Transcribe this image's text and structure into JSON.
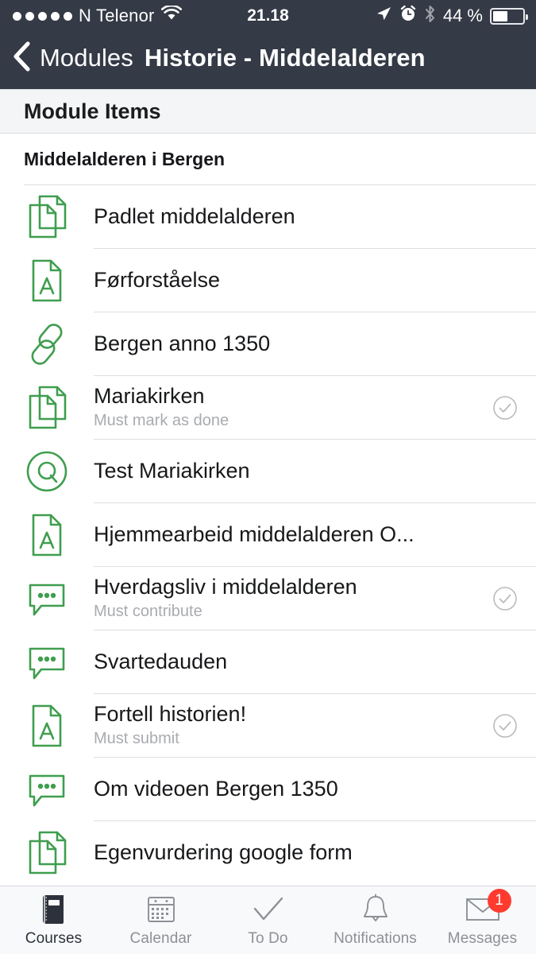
{
  "status_bar": {
    "signal_dots": 5,
    "carrier": "N Telenor",
    "wifi_icon": "wifi-icon",
    "time": "21.18",
    "location_icon": "location-arrow-icon",
    "alarm_icon": "alarm-clock-icon",
    "bluetooth_icon": "bluetooth-icon",
    "battery_percent": "44 %",
    "battery_icon": "battery-icon"
  },
  "navbar": {
    "back_icon": "chevron-left-icon",
    "back_label": "Modules",
    "title": "Historie - Middelalderen"
  },
  "section_header": {
    "label": "Module Items"
  },
  "module": {
    "title": "Middelalderen i Bergen"
  },
  "colors": {
    "navbar_bg": "#343a46",
    "icon_green": "#3f9e4f",
    "section_bg": "#f4f5f6",
    "separator": "#dcdee1",
    "subtitle_gray": "#a9abb0",
    "badge_red": "#ff3b30",
    "tab_inactive": "#8d9096",
    "tab_active": "#2d313b"
  },
  "items": [
    {
      "icon": "page-icon",
      "title": "Padlet middelalderen",
      "subtitle": "",
      "requirement_icon": ""
    },
    {
      "icon": "assignment-icon",
      "title": "Førforståelse",
      "subtitle": "",
      "requirement_icon": ""
    },
    {
      "icon": "link-icon",
      "title": "Bergen anno 1350",
      "subtitle": "",
      "requirement_icon": ""
    },
    {
      "icon": "page-icon",
      "title": "Mariakirken",
      "subtitle": "Must mark as done",
      "requirement_icon": "check-circle-icon"
    },
    {
      "icon": "quiz-icon",
      "title": "Test Mariakirken",
      "subtitle": "",
      "requirement_icon": ""
    },
    {
      "icon": "assignment-icon",
      "title": "Hjemmearbeid middelalderen O...",
      "subtitle": "",
      "requirement_icon": ""
    },
    {
      "icon": "discussion-icon",
      "title": "Hverdagsliv i middelalderen",
      "subtitle": "Must contribute",
      "requirement_icon": "check-circle-icon"
    },
    {
      "icon": "discussion-icon",
      "title": "Svartedauden",
      "subtitle": "",
      "requirement_icon": ""
    },
    {
      "icon": "assignment-icon",
      "title": "Fortell historien!",
      "subtitle": "Must submit",
      "requirement_icon": "check-circle-icon"
    },
    {
      "icon": "discussion-icon",
      "title": "Om videoen Bergen 1350",
      "subtitle": "",
      "requirement_icon": ""
    },
    {
      "icon": "page-icon",
      "title": "Egenvurdering google form",
      "subtitle": "",
      "requirement_icon": ""
    }
  ],
  "tabs": [
    {
      "label": "Courses",
      "icon": "book-icon",
      "active": true,
      "badge": ""
    },
    {
      "label": "Calendar",
      "icon": "calendar-icon",
      "active": false,
      "badge": ""
    },
    {
      "label": "To Do",
      "icon": "checkmark-icon",
      "active": false,
      "badge": ""
    },
    {
      "label": "Notifications",
      "icon": "bell-icon",
      "active": false,
      "badge": ""
    },
    {
      "label": "Messages",
      "icon": "envelope-icon",
      "active": false,
      "badge": "1"
    }
  ]
}
